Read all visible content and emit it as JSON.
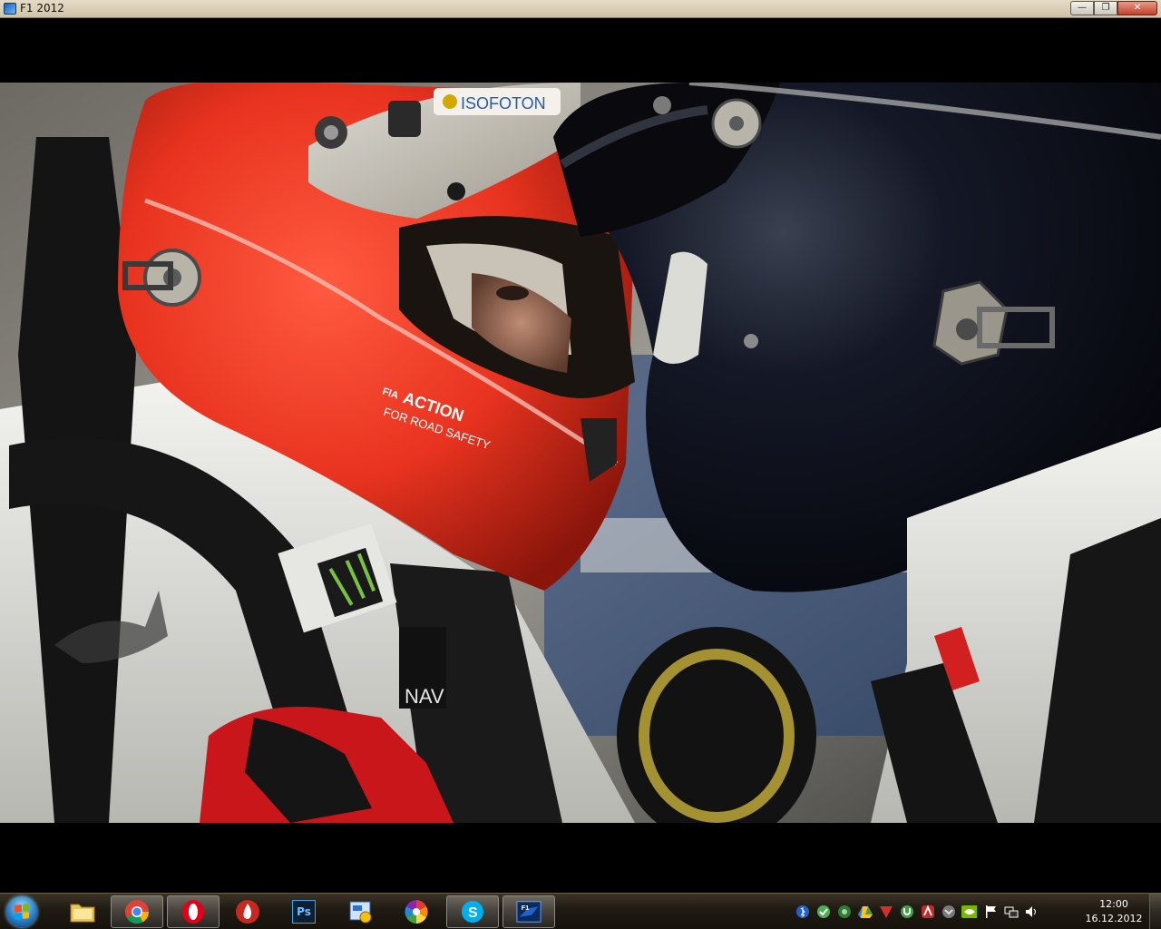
{
  "window": {
    "title": "F1 2012",
    "buttons": {
      "minimize": "—",
      "maximize": "❐",
      "close": "✕"
    }
  },
  "scene": {
    "helmet_red_text": "ACTION",
    "helmet_red_subtext": "FOR ROAD SAFETY",
    "helmet_red_fia": "FIA",
    "sponsor_visor": "ISOFOTON",
    "collar_text": "NAV",
    "colors": {
      "helmet_red": "#e8331f",
      "helmet_black": "#0c0f1c",
      "suit_white": "#e9e9e6"
    }
  },
  "taskbar": {
    "start": "start-orb",
    "apps": [
      {
        "name": "windows-explorer",
        "icon": "folder-icon",
        "active": false
      },
      {
        "name": "google-chrome",
        "icon": "chrome-icon",
        "active": true
      },
      {
        "name": "opera",
        "icon": "opera-icon",
        "active": true
      },
      {
        "name": "app-flame",
        "icon": "flame-icon",
        "active": false
      },
      {
        "name": "photoshop",
        "icon": "photoshop-icon",
        "label": "Ps",
        "active": false
      },
      {
        "name": "control-panel",
        "icon": "control-panel-icon",
        "active": false
      },
      {
        "name": "picasa",
        "icon": "picasa-icon",
        "active": false
      },
      {
        "name": "skype",
        "icon": "skype-icon",
        "active": true
      },
      {
        "name": "f1-2012",
        "icon": "f1-game-icon",
        "active": true
      }
    ],
    "tray_icons": [
      "bluetooth-icon",
      "network-green-icon",
      "puzzle-icon",
      "drive-icon",
      "antivirus-icon",
      "utorrent-icon",
      "avira-icon",
      "gateway-icon",
      "nvidia-icon",
      "action-center-flag-icon",
      "network-icon",
      "volume-icon"
    ],
    "clock": {
      "time": "12:00",
      "date": "16.12.2012"
    }
  }
}
